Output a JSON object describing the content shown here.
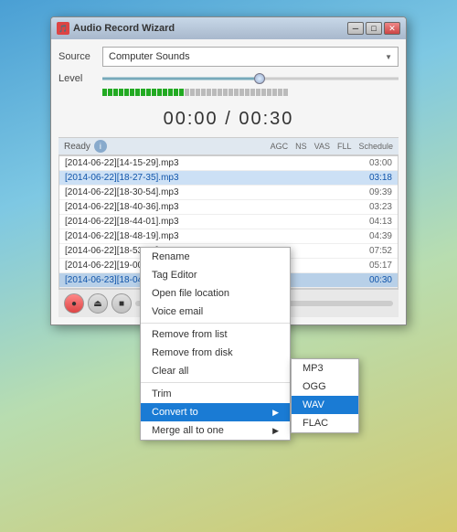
{
  "window": {
    "title": "Audio Record Wizard",
    "icon": "🎵"
  },
  "title_buttons": {
    "minimize": "─",
    "maximize": "□",
    "close": "✕"
  },
  "source": {
    "label": "Source",
    "value": "Computer Sounds",
    "arrow": "▼"
  },
  "level": {
    "label": "Level"
  },
  "timer": {
    "display": "00:00 / 00:30"
  },
  "toolbar": {
    "status": "Ready",
    "info_btn": "i",
    "labels": [
      "AGC",
      "NS",
      "VAS",
      "FLL",
      "Schedule"
    ]
  },
  "files": [
    {
      "name": "[2014-06-22][14-15-29].mp3",
      "duration": "03:00",
      "selected": false
    },
    {
      "name": "[2014-06-22][18-27-35].mp3",
      "duration": "03:18",
      "selected": true
    },
    {
      "name": "[2014-06-22][18-30-54].mp3",
      "duration": "09:39",
      "selected": false
    },
    {
      "name": "[2014-06-22][18-40-36].mp3",
      "duration": "03:23",
      "selected": false
    },
    {
      "name": "[2014-06-22][18-44-01].mp3",
      "duration": "04:13",
      "selected": false
    },
    {
      "name": "[2014-06-22][18-48-19].mp3",
      "duration": "04:39",
      "selected": false
    },
    {
      "name": "[2014-06-22][18-53-05].mp3",
      "duration": "07:52",
      "selected": false
    },
    {
      "name": "[2014-06-22][19-00-58].mp3",
      "duration": "05:17",
      "selected": false
    },
    {
      "name": "[2014-06-23][18-04-46].mp3",
      "duration": "00:30",
      "selected": false,
      "highlighted": true
    }
  ],
  "context_menu": {
    "items": [
      {
        "label": "Rename",
        "has_sub": false
      },
      {
        "label": "Tag Editor",
        "has_sub": false
      },
      {
        "label": "Open file location",
        "has_sub": false
      },
      {
        "label": "Voice email",
        "has_sub": false
      },
      {
        "label": "Remove from list",
        "has_sub": false
      },
      {
        "label": "Remove from disk",
        "has_sub": false
      },
      {
        "label": "Clear all",
        "has_sub": false
      },
      {
        "label": "Trim",
        "has_sub": false
      },
      {
        "label": "Convert to",
        "has_sub": true,
        "active": true
      },
      {
        "label": "Merge all to one",
        "has_sub": true
      }
    ]
  },
  "submenu": {
    "items": [
      {
        "label": "MP3",
        "active": false
      },
      {
        "label": "OGG",
        "active": false
      },
      {
        "label": "WAV",
        "active": true
      },
      {
        "label": "FLAC",
        "active": false
      }
    ]
  },
  "playback_btns": {
    "record": "●",
    "eject": "⏏",
    "stop": "■"
  }
}
